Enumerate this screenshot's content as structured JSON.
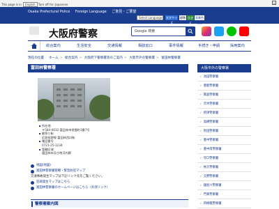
{
  "topbar": {
    "message_prefix": "This page is in",
    "language": "English",
    "message_suffix": "Turn off for: Japanese"
  },
  "header": {
    "police_name": "Osaka Prefectural Police",
    "foreign_language": "Foreign Language",
    "hearing_impaired": "ご意見・ご要望",
    "select_language": "Select Language",
    "btn_zoom": "文字サイズ",
    "btn_std": "標準",
    "btn_large": "大きく",
    "tag": "背景色変更"
  },
  "brand": {
    "title": "大阪府警察"
  },
  "search": {
    "placeholder": "Google 検索"
  },
  "nav": {
    "items": [
      "総合案内",
      "生活安全",
      "交通情報",
      "相談窓口",
      "事件情報",
      "手続き・申請",
      "採用案内"
    ]
  },
  "breadcrumb": [
    "現在の位置",
    "ホーム",
    "総合案内",
    "大阪府下警察署等のご案内",
    "大阪市外の警察署",
    "富田林警察署"
  ],
  "page": {
    "title": "富田林警察署"
  },
  "info": {
    "lines": [
      "所在地",
      "〒584-0032 富田林市常盤町3番7号",
      "最寄り駅",
      "近鉄長野線 富田林西口駅",
      "電話番号",
      "0721-25-1234",
      "管轄区域",
      "富田林市及び南河内郡"
    ]
  },
  "links": {
    "l1": "地図(地図)",
    "l2": "富田林警察署管轄・緊急防犯マップ",
    "plain": "交通事故発生マップは下記リンク先をご覧ください。",
    "l3": "犯罪発生マップはこちら",
    "l4": "富田林警察署のホームページはこちら（外部リンク）"
  },
  "subhead": {
    "label": "警察署案内図"
  },
  "sidebar": {
    "head": "大阪市外の警察署",
    "items": [
      "池田警察署",
      "豊能警察署",
      "箕面警察署",
      "茨木警察署",
      "摂津警察署",
      "高槻警察署",
      "吹田警察署",
      "豊中警察署",
      "豊中南警察署",
      "守口警察署",
      "枚方警察署",
      "交野警察署",
      "寝屋川警察署",
      "門真警察署",
      "四條畷警察署"
    ]
  },
  "colors": {
    "brand_blue": "#1a3d8f"
  }
}
